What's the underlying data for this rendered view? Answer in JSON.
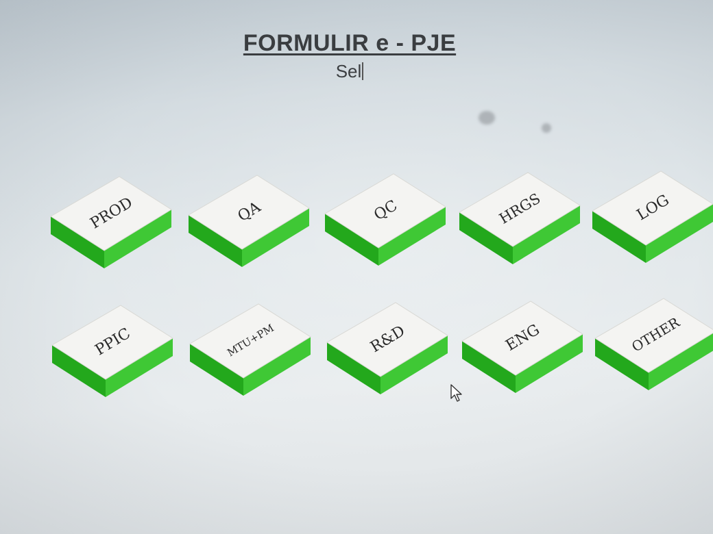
{
  "header": {
    "title": "FORMULIR e - PJE",
    "subtitle": "Sel"
  },
  "departments": [
    {
      "label": "PROD"
    },
    {
      "label": "QA"
    },
    {
      "label": "QC"
    },
    {
      "label": "HRGS"
    },
    {
      "label": "LOG"
    },
    {
      "label": "PPIC"
    },
    {
      "label": "MTU+PM"
    },
    {
      "label": "R&D"
    },
    {
      "label": "ENG"
    },
    {
      "label": "OTHER"
    }
  ],
  "colors": {
    "tile_top": "#f4f4f2",
    "tile_side_dark": "#23a81c",
    "tile_side_light": "#3fc835"
  }
}
